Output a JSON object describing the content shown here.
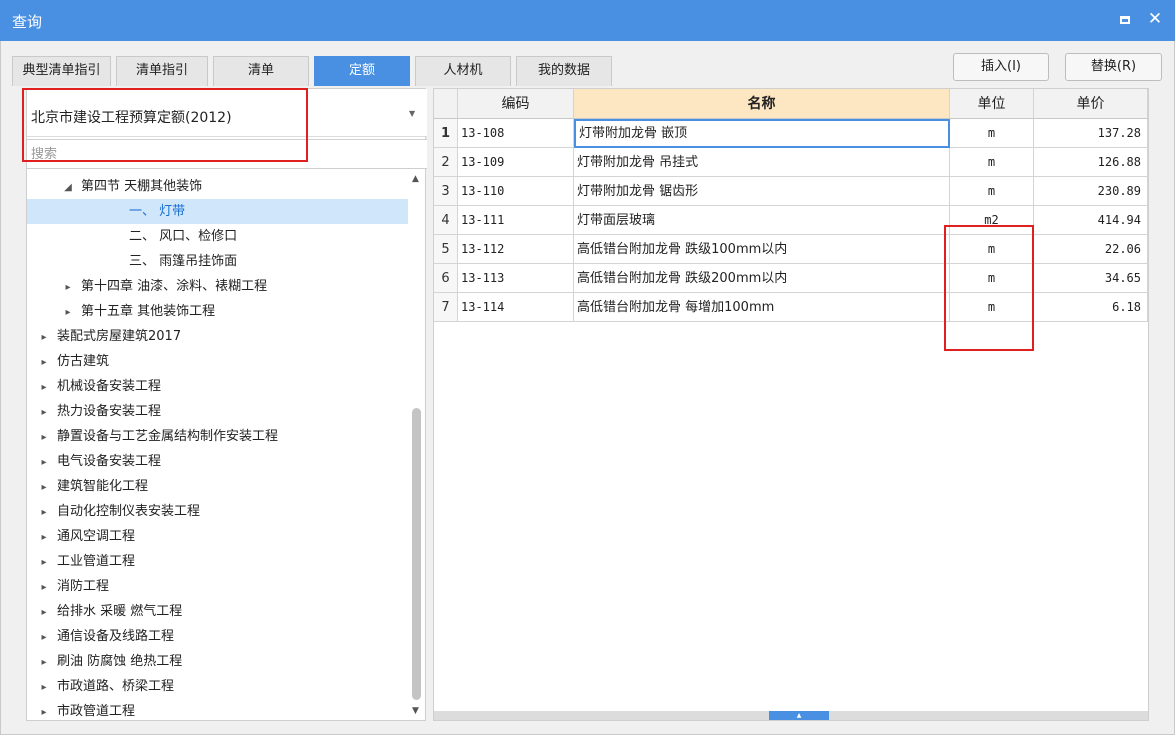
{
  "window": {
    "title": "查询"
  },
  "tabs": [
    {
      "label": "典型清单指引",
      "active": false
    },
    {
      "label": "清单指引",
      "active": false
    },
    {
      "label": "清单",
      "active": false
    },
    {
      "label": "定额",
      "active": true
    },
    {
      "label": "人材机",
      "active": false
    },
    {
      "label": "我的数据",
      "active": false
    }
  ],
  "actions": {
    "insert_label": "插入(I)",
    "replace_label": "替换(R)"
  },
  "left": {
    "library_selected": "北京市建设工程预算定额(2012)",
    "search_placeholder": "搜索",
    "tree": [
      {
        "label": "第四节 天棚其他装饰",
        "toggle": "◢",
        "indent": 1,
        "selected": false
      },
      {
        "label": "一、 灯带",
        "toggle": "",
        "indent": 3,
        "selected": true
      },
      {
        "label": "二、 风口、检修口",
        "toggle": "",
        "indent": 3,
        "selected": false
      },
      {
        "label": "三、 雨篷吊挂饰面",
        "toggle": "",
        "indent": 3,
        "selected": false
      },
      {
        "label": "第十四章 油漆、涂料、裱糊工程",
        "toggle": "▸",
        "indent": 1,
        "selected": false
      },
      {
        "label": "第十五章 其他装饰工程",
        "toggle": "▸",
        "indent": 1,
        "selected": false
      },
      {
        "label": "装配式房屋建筑2017",
        "toggle": "▸",
        "indent": 0,
        "selected": false
      },
      {
        "label": "仿古建筑",
        "toggle": "▸",
        "indent": 0,
        "selected": false
      },
      {
        "label": "机械设备安装工程",
        "toggle": "▸",
        "indent": 0,
        "selected": false
      },
      {
        "label": "热力设备安装工程",
        "toggle": "▸",
        "indent": 0,
        "selected": false
      },
      {
        "label": "静置设备与工艺金属结构制作安装工程",
        "toggle": "▸",
        "indent": 0,
        "selected": false
      },
      {
        "label": "电气设备安装工程",
        "toggle": "▸",
        "indent": 0,
        "selected": false
      },
      {
        "label": "建筑智能化工程",
        "toggle": "▸",
        "indent": 0,
        "selected": false
      },
      {
        "label": "自动化控制仪表安装工程",
        "toggle": "▸",
        "indent": 0,
        "selected": false
      },
      {
        "label": "通风空调工程",
        "toggle": "▸",
        "indent": 0,
        "selected": false
      },
      {
        "label": "工业管道工程",
        "toggle": "▸",
        "indent": 0,
        "selected": false
      },
      {
        "label": "消防工程",
        "toggle": "▸",
        "indent": 0,
        "selected": false
      },
      {
        "label": "给排水 采暖 燃气工程",
        "toggle": "▸",
        "indent": 0,
        "selected": false
      },
      {
        "label": "通信设备及线路工程",
        "toggle": "▸",
        "indent": 0,
        "selected": false
      },
      {
        "label": "刷油 防腐蚀 绝热工程",
        "toggle": "▸",
        "indent": 0,
        "selected": false
      },
      {
        "label": "市政道路、桥梁工程",
        "toggle": "▸",
        "indent": 0,
        "selected": false
      },
      {
        "label": "市政管道工程",
        "toggle": "▸",
        "indent": 0,
        "selected": false
      }
    ]
  },
  "grid": {
    "headers": [
      "编码",
      "名称",
      "单位",
      "单价"
    ],
    "rows": [
      {
        "no": "1",
        "code": "13-108",
        "name": "灯带附加龙骨 嵌顶",
        "unit": "m",
        "price": "137.28"
      },
      {
        "no": "2",
        "code": "13-109",
        "name": "灯带附加龙骨 吊挂式",
        "unit": "m",
        "price": "126.88"
      },
      {
        "no": "3",
        "code": "13-110",
        "name": "灯带附加龙骨 锯齿形",
        "unit": "m",
        "price": "230.89"
      },
      {
        "no": "4",
        "code": "13-111",
        "name": "灯带面层玻璃",
        "unit": "m2",
        "price": "414.94"
      },
      {
        "no": "5",
        "code": "13-112",
        "name": "高低错台附加龙骨 跌级100mm以内",
        "unit": "m",
        "price": "22.06"
      },
      {
        "no": "6",
        "code": "13-113",
        "name": "高低错台附加龙骨 跌级200mm以内",
        "unit": "m",
        "price": "34.65"
      },
      {
        "no": "7",
        "code": "13-114",
        "name": "高低错台附加龙骨 每增加100mm",
        "unit": "m",
        "price": "6.18"
      }
    ]
  },
  "icons": {
    "maximize": "maximize-icon",
    "close": "close-icon",
    "dropdown": "chevron-down-icon"
  },
  "colors": {
    "accent": "#4a90e2",
    "highlight": "#e02020",
    "selected_row": "#cfe6fb",
    "name_header": "#fde6c2"
  }
}
